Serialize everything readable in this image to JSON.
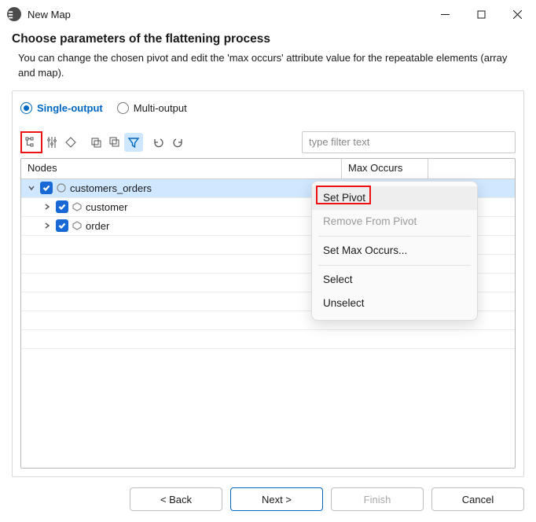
{
  "window": {
    "title": "New Map"
  },
  "header": {
    "heading": "Choose parameters of the flattening process",
    "description": "You can change the chosen pivot and edit the 'max occurs' attribute value for the repeatable elements (array and map)."
  },
  "radios": {
    "single": "Single-output",
    "multi": "Multi-output",
    "selected": "single"
  },
  "filter": {
    "placeholder": "type filter text"
  },
  "columns": {
    "nodes": "Nodes",
    "max": "Max Occurs"
  },
  "tree": {
    "root": {
      "label": "customers_orders",
      "checked": true,
      "expanded": true
    },
    "children": [
      {
        "label": "customer",
        "checked": true,
        "expanded": false
      },
      {
        "label": "order",
        "checked": true,
        "expanded": false
      }
    ]
  },
  "context_menu": {
    "set_pivot": "Set Pivot",
    "remove_pivot": "Remove From Pivot",
    "set_max": "Set Max Occurs...",
    "select": "Select",
    "unselect": "Unselect"
  },
  "buttons": {
    "back": "< Back",
    "next": "Next >",
    "finish": "Finish",
    "cancel": "Cancel"
  }
}
